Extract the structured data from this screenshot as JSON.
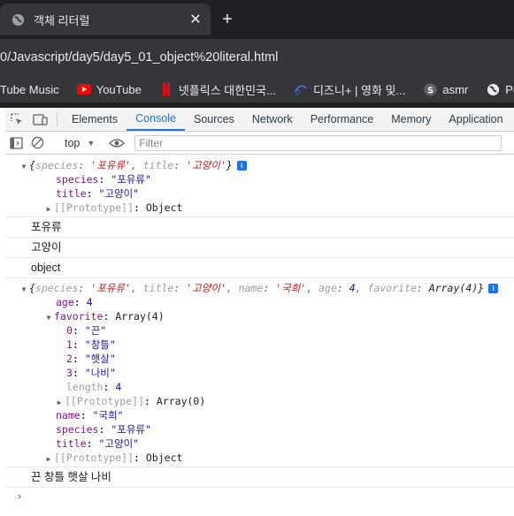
{
  "tab": {
    "title": "객체 리터럴",
    "close_glyph": "✕",
    "new_tab_glyph": "+"
  },
  "address": {
    "url": "0/Javascript/day5/day5_01_object%20literal.html"
  },
  "bookmarks": [
    {
      "label": "Tube Music",
      "icon": "none"
    },
    {
      "label": "YouTube",
      "icon": "youtube-icon"
    },
    {
      "label": "넷플릭스 대한민국...",
      "icon": "netflix-icon"
    },
    {
      "label": "디즈니+ | 영화 및...",
      "icon": "disney-icon"
    },
    {
      "label": "asmr",
      "icon": "s-icon"
    },
    {
      "label": "Pola",
      "icon": "globe-icon"
    }
  ],
  "devtools": {
    "tabs": [
      "Elements",
      "Console",
      "Sources",
      "Network",
      "Performance",
      "Memory",
      "Application"
    ],
    "active_tab": "Console",
    "context": "top",
    "filter_placeholder": "Filter"
  },
  "console": {
    "obj1": {
      "summary_open": "{",
      "k_species": "species",
      "v_species": "'포유류'",
      "k_title": "title",
      "v_title": "'고양이'",
      "summary_close": "}",
      "species_key": "species",
      "species_val": "\"포유류\"",
      "title_key": "title",
      "title_val": "\"고양이\"",
      "proto_key": "[[Prototype]]",
      "proto_val": "Object"
    },
    "log1": "포유류",
    "log2": "고양이",
    "log3": "object",
    "obj2": {
      "s_k_species": "species",
      "s_v_species": "'포유류'",
      "s_k_title": "title",
      "s_v_title": "'고양이'",
      "s_k_name": "name",
      "s_v_name": "'국희'",
      "s_k_age": "age",
      "s_v_age": "4",
      "s_k_favorite": "favorite",
      "s_v_favorite": "Array(4)",
      "age_key": "age",
      "age_val": "4",
      "favorite_key": "favorite",
      "favorite_val": "Array(4)",
      "fav_items": [
        {
          "k": "0",
          "v": "\"끈\""
        },
        {
          "k": "1",
          "v": "\"창틀\""
        },
        {
          "k": "2",
          "v": "\"햇살\""
        },
        {
          "k": "3",
          "v": "\"나비\""
        }
      ],
      "length_key": "length",
      "length_val": "4",
      "fav_proto_key": "[[Prototype]]",
      "fav_proto_val": "Array(0)",
      "name_key": "name",
      "name_val": "\"국희\"",
      "species_key": "species",
      "species_val": "\"포유류\"",
      "title_key": "title",
      "title_val": "\"고양이\"",
      "proto_key": "[[Prototype]]",
      "proto_val": "Object"
    },
    "log4": "끈 창틀 햇살 나비",
    "prompt": "›",
    "badge": "i"
  },
  "colors": {
    "accent": "#1a73e8",
    "key": "#881391",
    "string": "#1a1aa6",
    "number": "#1c00cf"
  }
}
